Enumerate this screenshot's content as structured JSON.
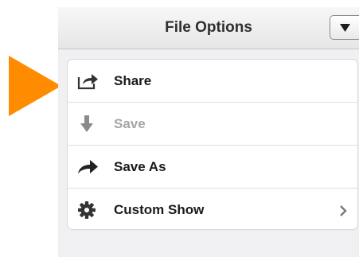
{
  "header": {
    "title": "File Options"
  },
  "menu": {
    "items": [
      {
        "label": "Share",
        "icon": "share-icon",
        "enabled": true
      },
      {
        "label": "Save",
        "icon": "download-arrow-icon",
        "enabled": false
      },
      {
        "label": "Save As",
        "icon": "forward-arrow-icon",
        "enabled": true
      },
      {
        "label": "Custom Show",
        "icon": "gear-icon",
        "enabled": true,
        "has_submenu": true
      }
    ]
  },
  "colors": {
    "pointer_arrow": "#ff8c00",
    "disabled_text": "#a6a6a6",
    "header_text": "#2f2f2f"
  }
}
